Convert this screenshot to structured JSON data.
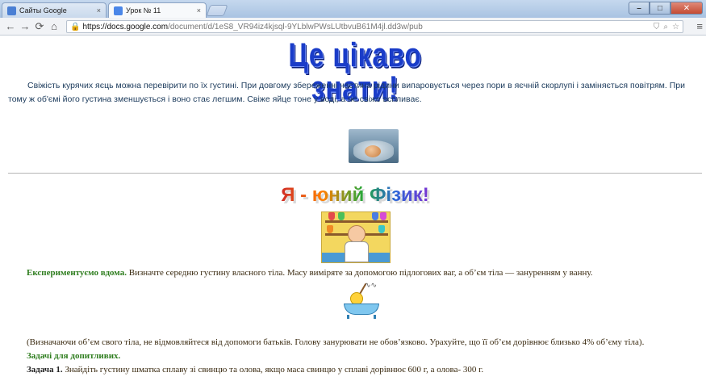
{
  "browser": {
    "tabs": [
      {
        "title": "Сайты Google",
        "close": "×",
        "active": false
      },
      {
        "title": "Урок № 11",
        "close": "×",
        "active": true
      }
    ],
    "url_host": "https://docs.google.com",
    "url_path": "/document/d/1eS8_VR94iz4kjsql-9YLblwPWsLUtbvuB61M4jl.dd3w/pub",
    "window_buttons": {
      "minimize": "–",
      "maximize": "□",
      "close": "✕"
    }
  },
  "document": {
    "heading_1": "Це цікаво знати!",
    "paragraph_1": "Свіжість курячих яєць можна перевірити по їх густині. При довгому збереженні частина рідини випаровується через пори в яєчній скорлупі і заміняється повітрям. При тому ж об'ємі його густина зменшується і воно стає легшим. Свіже яйце тоне у воді, а не свіже вспливає.",
    "heading_2": "Я - юний Фізик!",
    "experiment_lead": "Експериментуємо вдома.",
    "experiment_text": " Визначте середню густину власного тіла. Масу виміряте за допомогою підлогових ваг, а об’єм тіла — зануренням у ванну.",
    "note": "(Визначаючи об’єм свого тіла, не відмовляйтеся від допомоги батьків. Голову занурювати не обов’язково. Урахуйте, що її об’єм дорівнює близько 4% об’єму тіла).",
    "tasks_heading": "Задачі для допитливих.",
    "task1_label": "Задача 1.",
    "task1_text": " Знайдіть густину шматка сплаву зі свинцю та олова, якщо маса свинцю у сплаві дорівнює 600 г, а олова- 300 г."
  },
  "colors": {
    "heading_1": "#1a3cc8",
    "green_lead": "#2e7d1e",
    "paragraph_text": "#1c3b5c"
  }
}
